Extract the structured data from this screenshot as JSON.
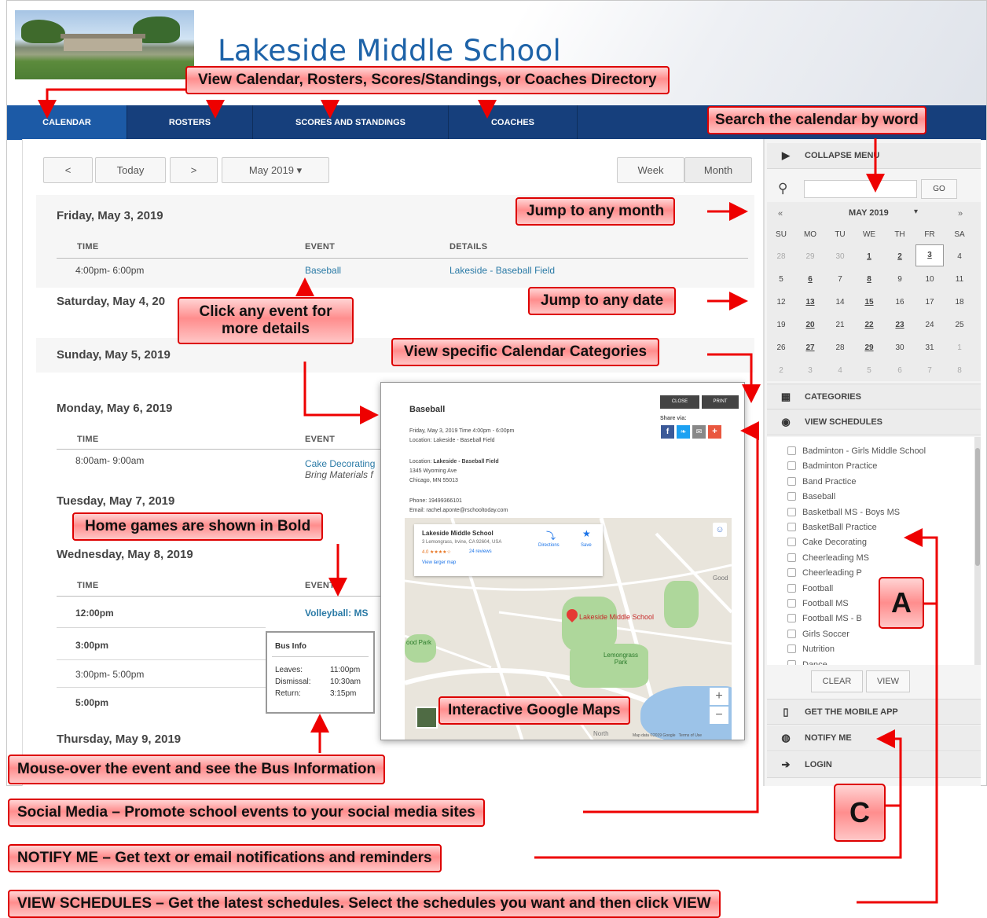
{
  "school_title": "Lakeside Middle School",
  "nav": {
    "tabs": [
      "CALENDAR",
      "ROSTERS",
      "SCORES AND STANDINGS",
      "COACHES"
    ]
  },
  "toolbar": {
    "prev": "<",
    "today": "Today",
    "next": ">",
    "month_select": "May 2019 ▾",
    "week": "Week",
    "month": "Month"
  },
  "days": {
    "d1": {
      "title": "Friday, May 3, 2019",
      "time_hdr": "TIME",
      "event_hdr": "EVENT",
      "details_hdr": "DETAILS",
      "time": "4:00pm- 6:00pm",
      "event": "Baseball",
      "details": "Lakeside - Baseball Field"
    },
    "d2": {
      "title": "Saturday, May 4, 20"
    },
    "d3": {
      "title": "Sunday, May 5, 2019"
    },
    "d4": {
      "title": "Monday, May 6, 2019",
      "time_hdr": "TIME",
      "event_hdr": "EVENT",
      "time": "8:00am- 9:00am",
      "event": "Cake Decorating",
      "event_note": "Bring Materials f"
    },
    "d5": {
      "title": "Tuesday, May 7, 2019"
    },
    "d6": {
      "title": "Wednesday, May 8, 2019",
      "time_hdr": "TIME",
      "event_hdr": "EVENT",
      "row1_time": "12:00pm",
      "row1_event": "Volleyball: MS",
      "row2_time": "3:00pm",
      "row3_time": "3:00pm- 5:00pm",
      "row4_time": "5:00pm"
    },
    "d7": {
      "title": "Thursday, May 9, 2019"
    }
  },
  "bus": {
    "title": "Bus Info",
    "l1": "Leaves:",
    "v1": "11:00pm",
    "l2": "Dismissal:",
    "v2": "10:30am",
    "l3": "Return:",
    "v3": "3:15pm"
  },
  "popup": {
    "title": "Baseball",
    "close": "CLOSE",
    "print": "PRINT",
    "share": "Share via:",
    "line1": "Friday, May 3, 2019 Time 4:00pm - 6:00pm",
    "line2": "Location: Lakeside - Baseball Field",
    "loc_label": "Location: ",
    "loc_name": "Lakeside - Baseball Field",
    "addr1": "1345 Wyoming Ave",
    "addr2": "Chicago, MN 55013",
    "phone": "Phone: 19499366101",
    "email": "Email: rachel.aponte@rschooltoday.com",
    "map_card_title": "Lakeside Middle School",
    "map_card_addr": "3 Lemongrass, Irvine, CA 92604, USA",
    "map_rating": "4.0 ★★★★☆",
    "map_reviews": "24 reviews",
    "map_larger": "View larger map",
    "directions": "Directions",
    "save": "Save",
    "map_pin": "Lakeside Middle School",
    "park1": "ood Park",
    "park2": "Lemongrass Park",
    "good": "Good",
    "north": "North",
    "map_footer": "Map data ©2019 Google   Terms of Use",
    "zoom_in": "+",
    "zoom_out": "−"
  },
  "sidebar": {
    "collapse": "COLLAPSE MENU",
    "go": "GO",
    "cal_prev": "«",
    "cal_month": "MAY 2019",
    "cal_caret": "▾",
    "cal_next": "»",
    "dows": [
      "SU",
      "MO",
      "TU",
      "WE",
      "TH",
      "FR",
      "SA"
    ],
    "weeks": [
      [
        "28",
        "29",
        "30",
        "1",
        "2",
        "3",
        "4"
      ],
      [
        "5",
        "6",
        "7",
        "8",
        "9",
        "10",
        "11"
      ],
      [
        "12",
        "13",
        "14",
        "15",
        "16",
        "17",
        "18"
      ],
      [
        "19",
        "20",
        "21",
        "22",
        "23",
        "24",
        "25"
      ],
      [
        "26",
        "27",
        "28",
        "29",
        "30",
        "31",
        "1"
      ],
      [
        "2",
        "3",
        "4",
        "5",
        "6",
        "7",
        "8"
      ]
    ],
    "categories": "CATEGORIES",
    "view_schedules": "VIEW SCHEDULES",
    "schedules": [
      "Badminton - Girls Middle School",
      "Badminton Practice",
      "Band Practice",
      "Baseball",
      "Basketball MS - Boys MS",
      "BasketBall Practice",
      "Cake Decorating",
      "Cheerleading MS",
      "Cheerleading P",
      "Football",
      "Football MS",
      "Football MS - B",
      "Girls Soccer",
      "Nutrition",
      "Dance"
    ],
    "clear": "CLEAR",
    "view": "VIEW",
    "mobile_app": "GET THE MOBILE APP",
    "notify": "NOTIFY ME",
    "login": "LOGIN"
  },
  "callouts": {
    "nav": "View Calendar, Rosters, Scores/Standings, or Coaches Directory",
    "search": "Search the calendar by word",
    "month": "Jump to any month",
    "date": "Jump to any date",
    "event": "Click any event for more details",
    "categories": "View specific Calendar Categories",
    "bold": "Home games are shown in Bold",
    "maps": "Interactive Google Maps",
    "bus": "Mouse-over the event and see the Bus Information",
    "social": "Social Media – Promote school events to your social media sites",
    "notify": "NOTIFY ME – Get text or email notifications and reminders",
    "schedules": "VIEW SCHEDULES – Get the latest schedules. Select the schedules you want and then click VIEW",
    "letter_a": "A",
    "letter_c": "C"
  },
  "colors": {
    "nav_bg": "#163f7c",
    "title_blue": "#1e63a8",
    "link": "#2a7aa6",
    "callout_border": "#dd0000",
    "callout_fill": "#ff8d8d"
  }
}
